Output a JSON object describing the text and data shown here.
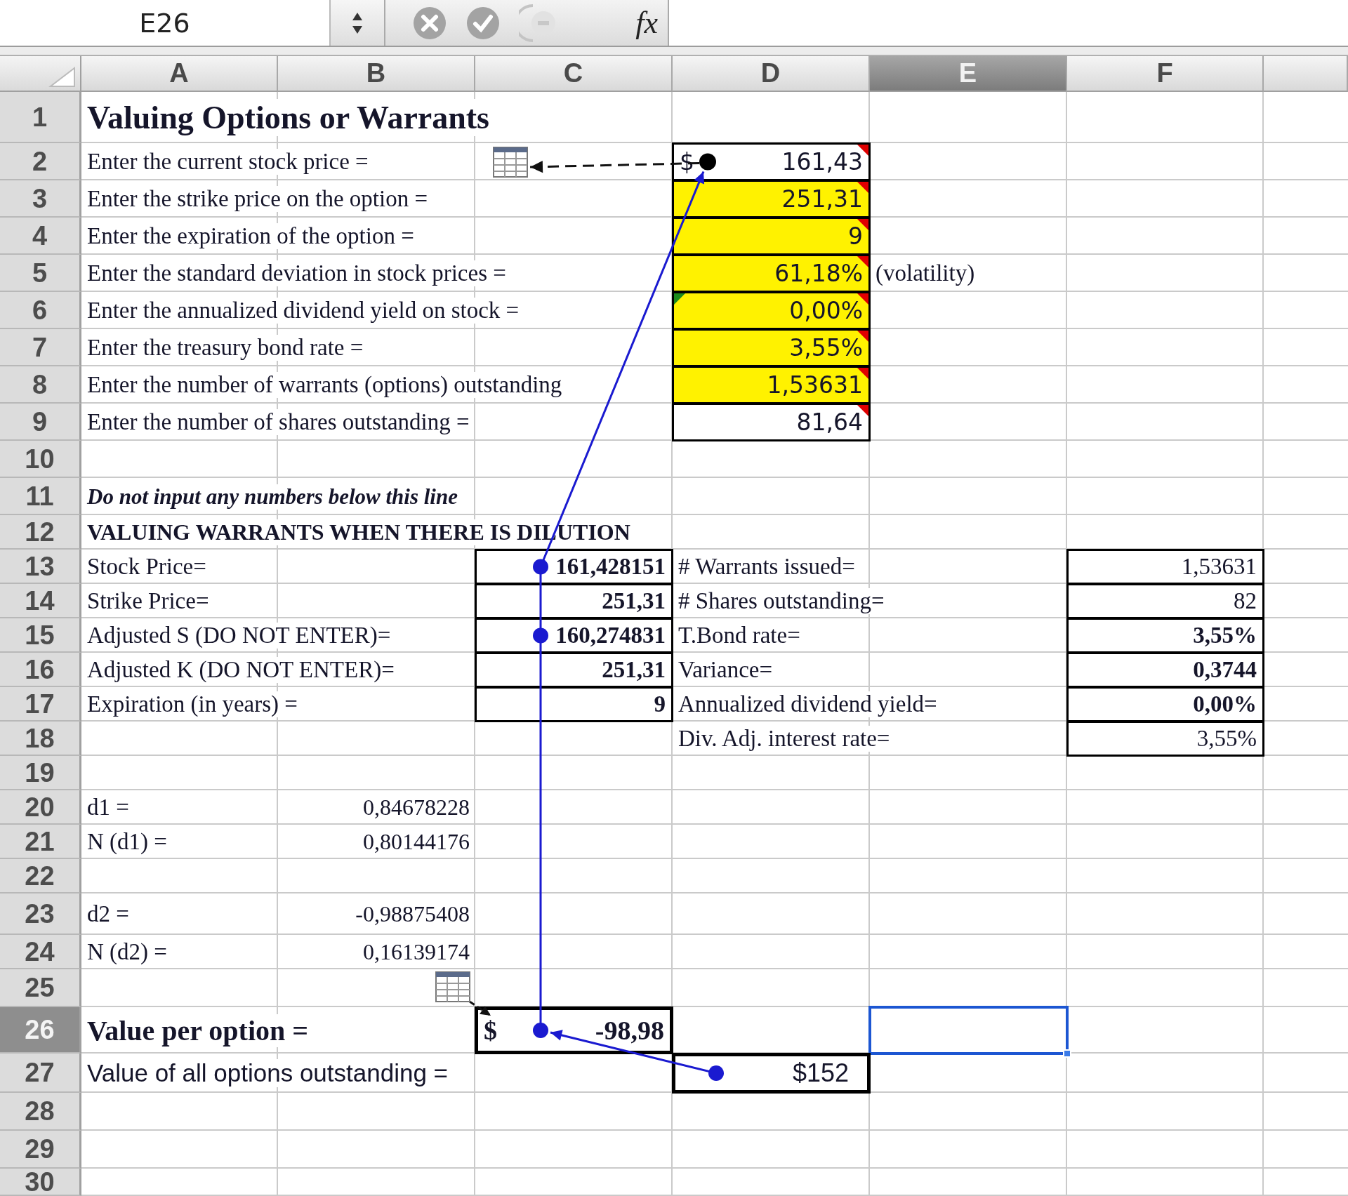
{
  "formula_bar": {
    "name_box": "E26",
    "buttons": [
      {
        "kind": "cancel",
        "disabled": true
      },
      {
        "kind": "enter",
        "disabled": true
      },
      {
        "kind": "wizard",
        "disabled": true
      }
    ],
    "fx_label": "fx"
  },
  "columns": [
    {
      "label": "A",
      "selected": false
    },
    {
      "label": "B",
      "selected": false
    },
    {
      "label": "C",
      "selected": false
    },
    {
      "label": "D",
      "selected": false
    },
    {
      "label": "E",
      "selected": true
    },
    {
      "label": "F",
      "selected": false
    }
  ],
  "rows": [
    {
      "number": "1",
      "selected": false,
      "cells": {
        "A": {
          "kind": "title",
          "text": "Valuing Options or Warrants"
        }
      }
    },
    {
      "number": "2",
      "selected": false,
      "cells": {
        "A": {
          "kind": "label",
          "text": "Enter the current stock price ="
        },
        "D": {
          "kind": "input",
          "currency": "$",
          "text": "161,43",
          "highlighted": false,
          "comment": true,
          "warning": false
        }
      }
    },
    {
      "number": "3",
      "selected": false,
      "cells": {
        "A": {
          "kind": "label",
          "text": "Enter the strike price on the option ="
        },
        "D": {
          "kind": "input",
          "text": "251,31",
          "highlighted": true,
          "comment": true,
          "warning": false
        }
      }
    },
    {
      "number": "4",
      "selected": false,
      "cells": {
        "A": {
          "kind": "label",
          "text": "Enter the expiration of the option ="
        },
        "D": {
          "kind": "input",
          "text": "9",
          "highlighted": true,
          "comment": true,
          "warning": false
        }
      }
    },
    {
      "number": "5",
      "selected": false,
      "cells": {
        "A": {
          "kind": "label",
          "text": "Enter the standard deviation in stock prices ="
        },
        "D": {
          "kind": "input",
          "text": "61,18%",
          "highlighted": true,
          "comment": true,
          "warning": false
        },
        "E": {
          "kind": "label",
          "text": "(volatility)"
        }
      }
    },
    {
      "number": "6",
      "selected": false,
      "cells": {
        "A": {
          "kind": "label",
          "text": "Enter the annualized dividend yield on stock ="
        },
        "D": {
          "kind": "input",
          "text": "0,00%",
          "highlighted": true,
          "comment": true,
          "warning": true
        }
      }
    },
    {
      "number": "7",
      "selected": false,
      "cells": {
        "A": {
          "kind": "label",
          "text": "Enter the treasury bond rate ="
        },
        "D": {
          "kind": "input",
          "text": "3,55%",
          "highlighted": true,
          "comment": true,
          "warning": false
        }
      }
    },
    {
      "number": "8",
      "selected": false,
      "cells": {
        "A": {
          "kind": "label",
          "text": "Enter the number of warrants (options) outstanding"
        },
        "D": {
          "kind": "input",
          "text": "1,53631",
          "highlighted": true,
          "comment": true,
          "warning": false
        }
      }
    },
    {
      "number": "9",
      "selected": false,
      "cells": {
        "A": {
          "kind": "label",
          "text": "Enter the number of shares outstanding ="
        },
        "D": {
          "kind": "input",
          "text": "81,64",
          "highlighted": false,
          "comment": true,
          "warning": false
        }
      }
    },
    {
      "number": "10",
      "selected": false,
      "cells": {}
    },
    {
      "number": "11",
      "selected": false,
      "cells": {
        "A": {
          "kind": "note",
          "text": "Do not input any numbers below this line"
        }
      }
    },
    {
      "number": "12",
      "selected": false,
      "cells": {
        "A": {
          "kind": "heading",
          "text": "VALUING WARRANTS WHEN THERE IS DILUTION"
        }
      }
    },
    {
      "number": "13",
      "selected": false,
      "cells": {
        "A": {
          "kind": "label",
          "text": "Stock Price="
        },
        "C": {
          "kind": "result-bold",
          "text": "161,428151"
        },
        "D": {
          "kind": "label",
          "text": "# Warrants issued="
        },
        "F": {
          "kind": "result",
          "text": "1,53631"
        }
      }
    },
    {
      "number": "14",
      "selected": false,
      "cells": {
        "A": {
          "kind": "label",
          "text": "Strike Price="
        },
        "C": {
          "kind": "result-bold",
          "text": "251,31"
        },
        "D": {
          "kind": "label",
          "text": "# Shares outstanding="
        },
        "F": {
          "kind": "result",
          "text": "82"
        }
      }
    },
    {
      "number": "15",
      "selected": false,
      "cells": {
        "A": {
          "kind": "label",
          "text": "Adjusted S (DO NOT ENTER)="
        },
        "C": {
          "kind": "result-bold",
          "text": "160,274831"
        },
        "D": {
          "kind": "label",
          "text": "T.Bond rate="
        },
        "F": {
          "kind": "result-bold",
          "text": "3,55%"
        }
      }
    },
    {
      "number": "16",
      "selected": false,
      "cells": {
        "A": {
          "kind": "label",
          "text": "Adjusted K (DO NOT ENTER)="
        },
        "C": {
          "kind": "result-bold",
          "text": "251,31"
        },
        "D": {
          "kind": "label",
          "text": "Variance="
        },
        "F": {
          "kind": "result-bold",
          "text": "0,3744"
        }
      }
    },
    {
      "number": "17",
      "selected": false,
      "cells": {
        "A": {
          "kind": "label",
          "text": "Expiration (in years) ="
        },
        "C": {
          "kind": "result-bold",
          "text": "9"
        },
        "D": {
          "kind": "label",
          "text": "Annualized dividend yield="
        },
        "F": {
          "kind": "result-bold",
          "text": "0,00%"
        }
      }
    },
    {
      "number": "18",
      "selected": false,
      "cells": {
        "D": {
          "kind": "label",
          "text": "Div. Adj. interest rate="
        },
        "F": {
          "kind": "result",
          "text": "3,55%"
        }
      }
    },
    {
      "number": "19",
      "selected": false,
      "cells": {}
    },
    {
      "number": "20",
      "selected": false,
      "cells": {
        "A": {
          "kind": "label",
          "text": "d1 ="
        },
        "B": {
          "kind": "value",
          "text": "0,84678228"
        }
      }
    },
    {
      "number": "21",
      "selected": false,
      "cells": {
        "A": {
          "kind": "label",
          "text": "N (d1) ="
        },
        "B": {
          "kind": "value",
          "text": "0,80144176"
        }
      }
    },
    {
      "number": "22",
      "selected": false,
      "cells": {}
    },
    {
      "number": "23",
      "selected": false,
      "cells": {
        "A": {
          "kind": "label",
          "text": "d2 ="
        },
        "B": {
          "kind": "value",
          "text": "-0,98875408"
        }
      }
    },
    {
      "number": "24",
      "selected": false,
      "cells": {
        "A": {
          "kind": "label",
          "text": "N (d2) ="
        },
        "B": {
          "kind": "value",
          "text": "0,16139174"
        }
      }
    },
    {
      "number": "25",
      "selected": false,
      "cells": {}
    },
    {
      "number": "26",
      "selected": true,
      "cells": {
        "A": {
          "kind": "total-label",
          "text": "Value per option ="
        },
        "C": {
          "kind": "total",
          "currency": "$",
          "text": "-98,98"
        }
      }
    },
    {
      "number": "27",
      "selected": false,
      "cells": {
        "A": {
          "kind": "sans-label",
          "text": "Value of all options outstanding ="
        },
        "D": {
          "kind": "sans-total",
          "text": "$152"
        }
      }
    },
    {
      "number": "28",
      "selected": false,
      "cells": {}
    },
    {
      "number": "29",
      "selected": false,
      "cells": {}
    },
    {
      "number": "30",
      "selected": false,
      "cells": {}
    }
  ]
}
